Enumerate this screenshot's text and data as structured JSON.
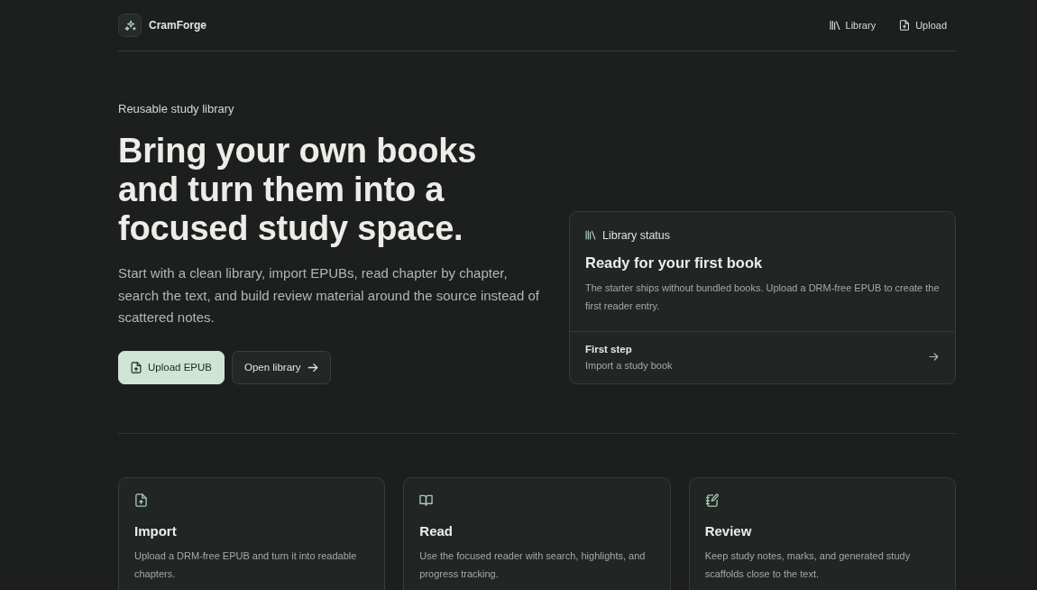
{
  "header": {
    "brand": "CramForge",
    "nav": [
      {
        "label": "Library"
      },
      {
        "label": "Upload"
      }
    ]
  },
  "hero": {
    "eyebrow": "Reusable study library",
    "title": "Bring your own books and turn them into a focused study space.",
    "description": "Start with a clean library, import EPUBs, read chapter by chapter, search the text, and build review material around the source instead of scattered notes.",
    "buttons": [
      {
        "label": "Upload EPUB",
        "kind": "primary"
      },
      {
        "label": "Open library",
        "kind": "secondary"
      }
    ]
  },
  "status_card": {
    "label": "Library status",
    "title": "Ready for your first book",
    "description": "The starter ships without bundled books. Upload a DRM-free EPUB to create the first reader entry.",
    "step": {
      "title": "First step",
      "text": "Import a study book"
    }
  },
  "features": [
    {
      "title": "Import",
      "description": "Upload a DRM-free EPUB and turn it into readable chapters."
    },
    {
      "title": "Read",
      "description": "Use the focused reader with search, highlights, and progress tracking."
    },
    {
      "title": "Review",
      "description": "Keep study notes, marks, and generated study scaffolds close to the text."
    }
  ]
}
